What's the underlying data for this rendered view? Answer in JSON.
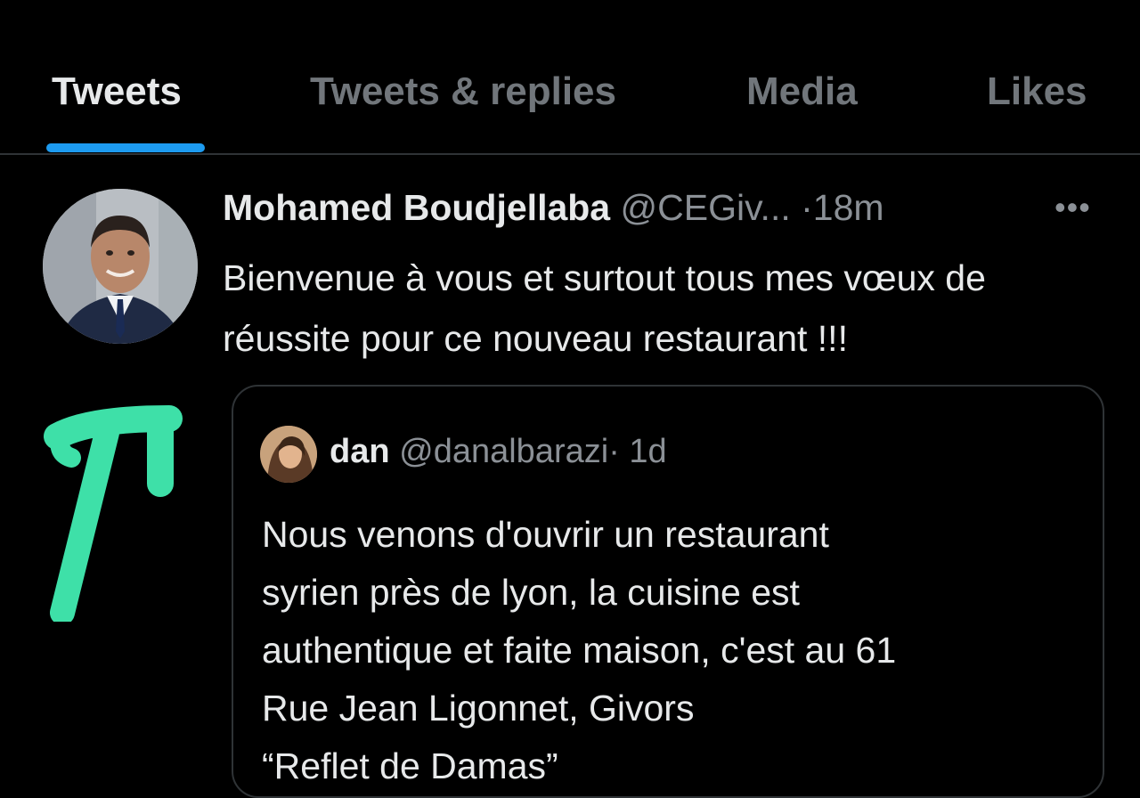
{
  "colors": {
    "background": "#000000",
    "accent": "#1d9bf0",
    "annotation": "#3ee0a8"
  },
  "tabs": [
    {
      "label": "Tweets",
      "active": true
    },
    {
      "label": "Tweets & replies",
      "active": false
    },
    {
      "label": "Media",
      "active": false
    },
    {
      "label": "Likes",
      "active": false
    }
  ],
  "tweet": {
    "author_name": "Mohamed Boudjellaba",
    "author_handle": "@CEGiv...",
    "time": "·18m",
    "more_icon": "more-horizontal-icon",
    "text": "Bienvenue à vous et surtout tous mes vœux de réussite pour ce nouveau restaurant !!!"
  },
  "quoted_tweet": {
    "author_name": "dan",
    "author_handle": "@danalbarazi",
    "time": "· 1d",
    "text_lines": [
      "Nous venons d'ouvrir un restaurant",
      "syrien près de lyon, la cuisine est",
      "authentique et faite maison, c'est au 61",
      "Rue Jean Ligonnet, Givors",
      "“Reflet de Damas”"
    ]
  }
}
